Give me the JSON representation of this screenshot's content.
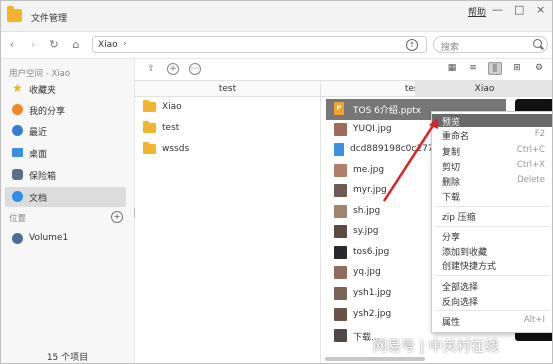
{
  "window": {
    "title": "文件管理",
    "help_label": "帮助",
    "controls": {
      "minimize": "—",
      "maximize": "□",
      "close": "×"
    }
  },
  "toolbar": {
    "path": "Xiao",
    "search_placeholder": "搜索"
  },
  "sidebar": {
    "header": "用户空间 - Xiao",
    "items": [
      {
        "label": "收藏夹",
        "icon": "star-icon",
        "color": "#f0b31c"
      },
      {
        "label": "我的分享",
        "icon": "share-icon",
        "color": "#f08a24"
      },
      {
        "label": "最近",
        "icon": "clock-icon",
        "color": "#3a7bd5"
      },
      {
        "label": "桌面",
        "icon": "desktop-icon",
        "color": "#3b8fe2"
      },
      {
        "label": "保险箱",
        "icon": "safe-icon",
        "color": "#5a6f8a"
      },
      {
        "label": "文档",
        "icon": "document-icon",
        "color": "#2f8fe5",
        "selected": true
      }
    ],
    "location_header": "位置",
    "volumes": [
      {
        "label": "Volume1",
        "icon": "disk-icon"
      }
    ],
    "footer": "15 个项目"
  },
  "columns": {
    "headers": [
      "test",
      "test",
      "Xiao"
    ],
    "active_index": 2
  },
  "column1": {
    "folders": [
      "Xiao",
      "test",
      "wssds"
    ]
  },
  "column2": {
    "files": [
      {
        "name": "TOS 6介绍.pptx",
        "type": "pptx",
        "selected": true
      },
      {
        "name": "YUQI.jpg",
        "type": "jpg",
        "thumb": "#9c6b5a"
      },
      {
        "name": "dcd889198c0c277…",
        "type": "doc"
      },
      {
        "name": "me.jpg",
        "type": "jpg",
        "thumb": "#b07f6a"
      },
      {
        "name": "myr.jpg",
        "type": "jpg",
        "thumb": "#6d5a52"
      },
      {
        "name": "sh.jpg",
        "type": "jpg",
        "thumb": "#a38470"
      },
      {
        "name": "sy.jpg",
        "type": "jpg",
        "thumb": "#5e4a3f"
      },
      {
        "name": "tos6.jpg",
        "type": "jpg",
        "thumb": "#27292e"
      },
      {
        "name": "yq.jpg",
        "type": "jpg",
        "thumb": "#8f6c5e"
      },
      {
        "name": "ysh1.jpg",
        "type": "jpg",
        "thumb": "#7a6358"
      },
      {
        "name": "ysh2.jpg",
        "type": "jpg",
        "thumb": "#6b5246"
      },
      {
        "name": "下载…",
        "type": "jpg",
        "thumb": "#4f4a48"
      }
    ]
  },
  "context_menu": {
    "items": [
      {
        "label": "预览",
        "shortcut": "",
        "highlighted": true
      },
      {
        "label": "重命名",
        "shortcut": "F2"
      },
      {
        "label": "复制",
        "shortcut": "Ctrl+C"
      },
      {
        "label": "剪切",
        "shortcut": "Ctrl+X"
      },
      {
        "label": "删除",
        "shortcut": "Delete"
      },
      {
        "label": "下载",
        "shortcut": ""
      },
      {
        "label": "zip 压缩",
        "shortcut": ""
      },
      {
        "label": "分享",
        "shortcut": ""
      },
      {
        "label": "添加到收藏",
        "shortcut": ""
      },
      {
        "label": "创建快捷方式",
        "shortcut": ""
      },
      {
        "label": "全部选择",
        "shortcut": ""
      },
      {
        "label": "反向选择",
        "shortcut": ""
      },
      {
        "label": "属性",
        "shortcut": "Alt+I"
      }
    ]
  },
  "watermark": "网易号 | 中关村在线",
  "colors": {
    "accent_folder": "#f3b530",
    "selection": "#6a6a6a",
    "annotation_arrow": "#e02020"
  }
}
